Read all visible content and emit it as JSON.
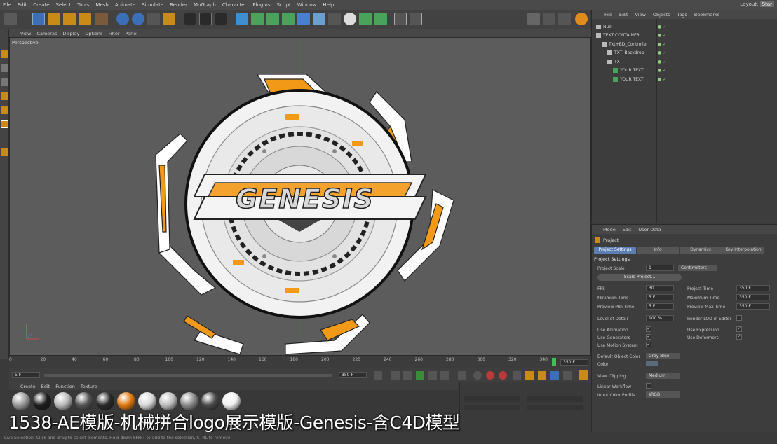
{
  "menubar": [
    "File",
    "Edit",
    "Create",
    "Select",
    "Tools",
    "Mesh",
    "Animate",
    "Simulate",
    "Render",
    "MoGraph",
    "Character",
    "Plugins",
    "Script",
    "Window",
    "Help"
  ],
  "layout": {
    "label": "Layout:",
    "value": "Star"
  },
  "viewport": {
    "menu": [
      "View",
      "Cameras",
      "Display",
      "Options",
      "Filter",
      "Panel"
    ],
    "label": "Perspective",
    "logo_text": "GENESIS"
  },
  "timeline": {
    "ticks": [
      "0",
      "20",
      "40",
      "60",
      "80",
      "100",
      "120",
      "140",
      "160",
      "180",
      "200",
      "220",
      "240",
      "260",
      "280",
      "300",
      "320",
      "340"
    ],
    "end_field": "350 F",
    "start_field": "0 F",
    "current_field": "5 F",
    "max_field": "350 F"
  },
  "materials": {
    "menu": [
      "Create",
      "Edit",
      "Function",
      "Texture"
    ],
    "count": 11
  },
  "object_manager": {
    "menu": [
      "File",
      "Edit",
      "View",
      "Objects",
      "Tags",
      "Bookmarks"
    ],
    "objects": [
      {
        "name": "Null",
        "indent": 0
      },
      {
        "name": "TEXT CONTAINER",
        "indent": 0
      },
      {
        "name": "Txt+BD_Controller",
        "indent": 1
      },
      {
        "name": "TXT_Backdrop",
        "indent": 2
      },
      {
        "name": "TXT",
        "indent": 2
      },
      {
        "name": "YOUR TEXT",
        "indent": 3
      },
      {
        "name": "YOUR TEXT",
        "indent": 3
      }
    ]
  },
  "attributes": {
    "menu": [
      "Mode",
      "Edit",
      "User Data"
    ],
    "title": "Project",
    "tabs": [
      "Project Settings",
      "Info",
      "Dynamics",
      "Key Interpolation"
    ],
    "section": "Project Settings",
    "project_scale_label": "Project Scale",
    "project_scale_value": "1",
    "units": "Centimeters",
    "scale_button": "Scale Project...",
    "fps_label": "FPS",
    "fps_value": "30",
    "project_time_label": "Project Time",
    "project_time_value": "350 F",
    "min_time_label": "Minimum Time",
    "min_time_value": "5 F",
    "max_time_label": "Maximum Time",
    "max_time_value": "350 F",
    "prev_min_label": "Preview Min Time",
    "prev_min_value": "5 F",
    "prev_max_label": "Preview Max Time",
    "prev_max_value": "350 F",
    "lod_label": "Level of Detail",
    "lod_value": "100 %",
    "render_lod_label": "Render LOD in Editor",
    "use_anim_label": "Use Animation",
    "use_expr_label": "Use Expression",
    "use_gen_label": "Use Generators",
    "use_def_label": "Use Deformers",
    "use_motion_label": "Use Motion System",
    "default_color_label": "Default Object Color",
    "default_color_value": "Gray-Blue",
    "color_label": "Color",
    "view_clipping_label": "View Clipping",
    "view_clipping_value": "Medium",
    "linear_workflow_label": "Linear Workflow",
    "input_color_label": "Input Color Profile",
    "input_color_value": "sRGB"
  },
  "caption": "1538-AE模版-机械拼合logo展示模版-Genesis-含C4D模型",
  "status": "Live Selection: Click and drag to select elements. Hold down SHIFT to add to the selection, CTRL to remove."
}
